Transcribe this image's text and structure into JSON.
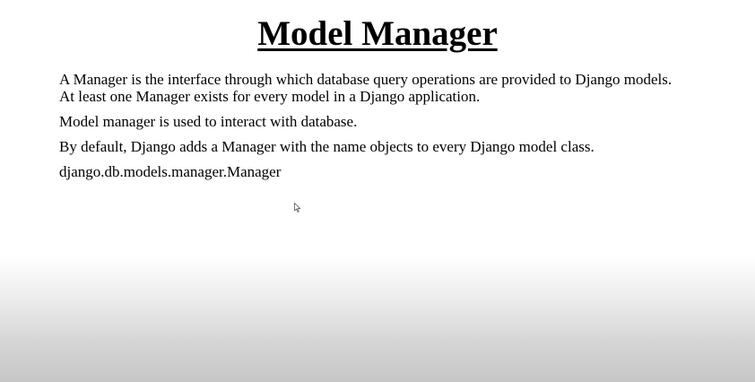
{
  "slide": {
    "title": "Model Manager",
    "paragraphs": [
      {
        "lines": [
          "A Manager is the interface through which database query operations are provided to Django models.",
          "At least one Manager exists for every model in a Django application."
        ]
      },
      {
        "lines": [
          "Model manager is used to interact with database."
        ]
      },
      {
        "lines": [
          "By default, Django adds a Manager with the name objects to every Django model class."
        ]
      },
      {
        "lines": [
          "django.db.models.manager.Manager"
        ]
      }
    ]
  },
  "icons": {
    "cursor": "mouse-pointer-icon"
  }
}
